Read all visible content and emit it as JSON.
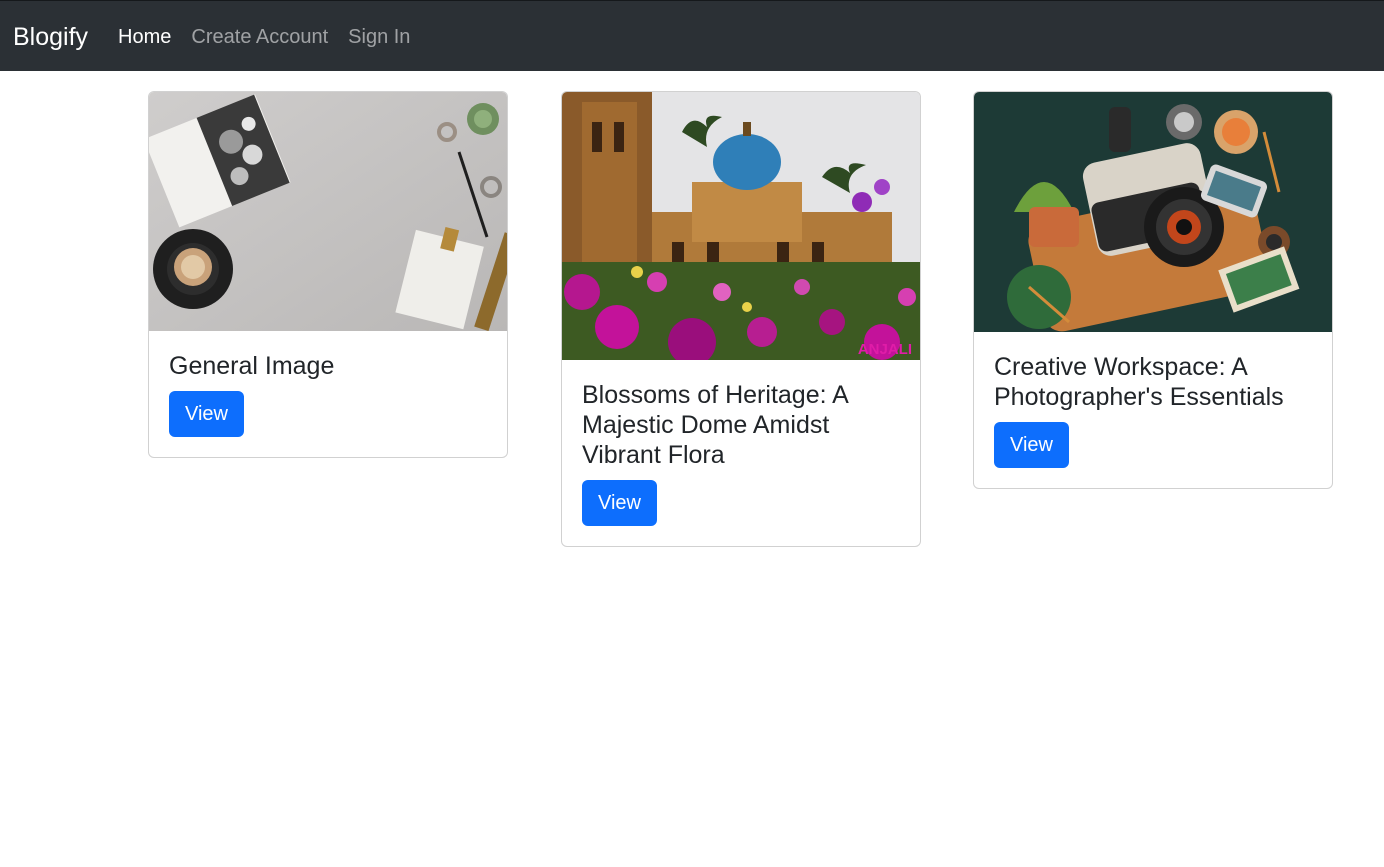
{
  "navbar": {
    "brand": "Blogify",
    "links": [
      {
        "label": "Home",
        "active": true
      },
      {
        "label": "Create Account",
        "active": false
      },
      {
        "label": "Sign In",
        "active": false
      }
    ]
  },
  "posts": [
    {
      "title": "General Image",
      "button_label": "View"
    },
    {
      "title": "Blossoms of Heritage: A Majestic Dome Amidst Vibrant Flora",
      "button_label": "View",
      "image_watermark": "ANJALI"
    },
    {
      "title": "Creative Workspace: A Photographer's Essentials",
      "button_label": "View"
    }
  ],
  "colors": {
    "navbar_bg": "#2b3035",
    "button_primary": "#0d6efd"
  }
}
